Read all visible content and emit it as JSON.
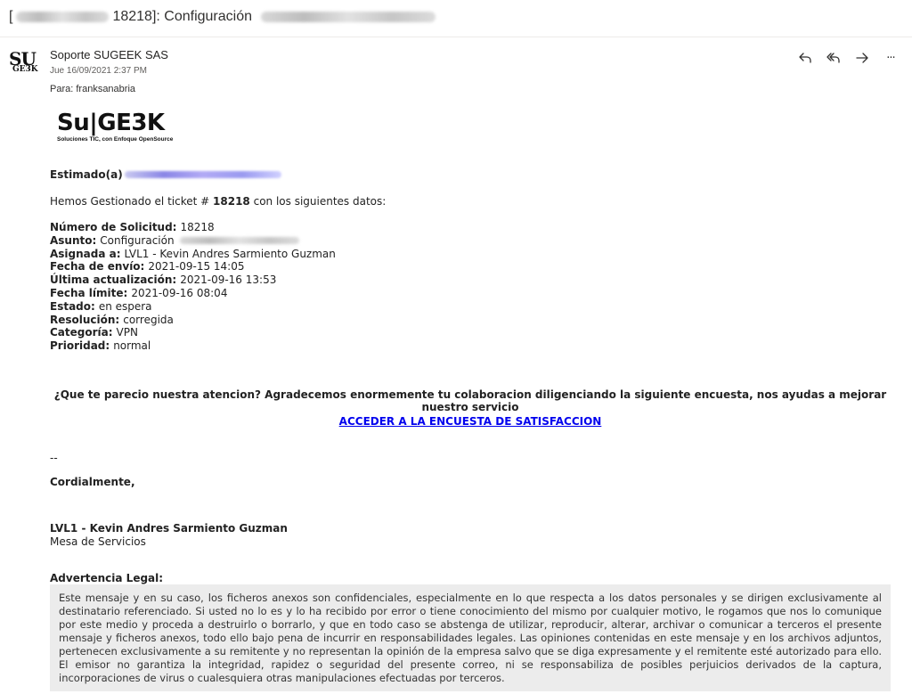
{
  "subject": {
    "prefix": "[",
    "ticket_suffix": "18218]: Configuración"
  },
  "sender": {
    "avatar_top": "SU",
    "avatar_bottom": "GE3K",
    "name": "Soporte SUGEEK SAS",
    "date": "Jue 16/09/2021 2:37 PM",
    "to_label": "Para:",
    "to_value": "franksanabria"
  },
  "actions": [
    {
      "icon": "reply-icon"
    },
    {
      "icon": "reply-all-icon"
    },
    {
      "icon": "forward-icon"
    },
    {
      "icon": "more-icon",
      "glyph": "···"
    }
  ],
  "logo": {
    "main": "Su|GE3K",
    "tagline": "Soluciones TIC, con Enfoque OpenSource"
  },
  "email": {
    "greeting": "Estimado(a)",
    "intro_before": "Hemos Gestionado el ticket #",
    "intro_ticket": "18218",
    "intro_after": "con los siguientes datos:",
    "fields": [
      {
        "key": "Número de Solicitud:",
        "value": "18218"
      },
      {
        "key": "Asunto:",
        "value": "Configuración"
      },
      {
        "key": "Asignada a:",
        "value": "LVL1 - Kevin Andres Sarmiento Guzman"
      },
      {
        "key": "Fecha de envío:",
        "value": "2021-09-15 14:05"
      },
      {
        "key": "Última actualización:",
        "value": "2021-09-16 13:53"
      },
      {
        "key": "Fecha límite:",
        "value": "2021-09-16 08:04"
      },
      {
        "key": "Estado:",
        "value": "en espera"
      },
      {
        "key": "Resolución:",
        "value": "corregida"
      },
      {
        "key": "Categoría:",
        "value": "VPN"
      },
      {
        "key": "Prioridad:",
        "value": "normal"
      }
    ],
    "survey_text": "¿Que te parecio nuestra atencion? Agradecemos enormemente tu colaboracion diligenciando la siguiente encuesta, nos ayudas a mejorar nuestro servicio",
    "survey_link": "ACCEDER A LA ENCUESTA DE SATISFACCION",
    "dashes": "--",
    "closing": "Cordialmente,",
    "signature_name": "LVL1 - Kevin Andres Sarmiento Guzman",
    "signature_role": "Mesa de Servicios",
    "legal_title": "Advertencia Legal:",
    "legal_text": "Este mensaje y en su caso, los ficheros anexos son confidenciales, especialmente en lo que respecta a los datos personales y se dirigen exclusivamente al destinatario referenciado. Si usted no lo es y lo ha recibido por error o tiene conocimiento del mismo por cualquier motivo, le rogamos que nos lo comunique por este medio y proceda a destruirlo o borrarlo, y que en todo caso se abstenga de utilizar, reproducir, alterar, archivar o comunicar a terceros el presente mensaje y ficheros anexos, todo ello bajo pena de incurrir en responsabilidades legales. Las opiniones contenidas en este mensaje y en los archivos adjuntos, pertenecen exclusivamente a su remitente y no representan la opinión de la empresa salvo que se diga expresamente y el remitente esté autorizado para ello. El emisor no garantiza la integridad, rapidez o seguridad del presente correo, ni se responsabiliza de posibles perjuicios derivados de la captura, incorporaciones de virus o cualesquiera otras manipulaciones efectuadas por terceros."
  }
}
